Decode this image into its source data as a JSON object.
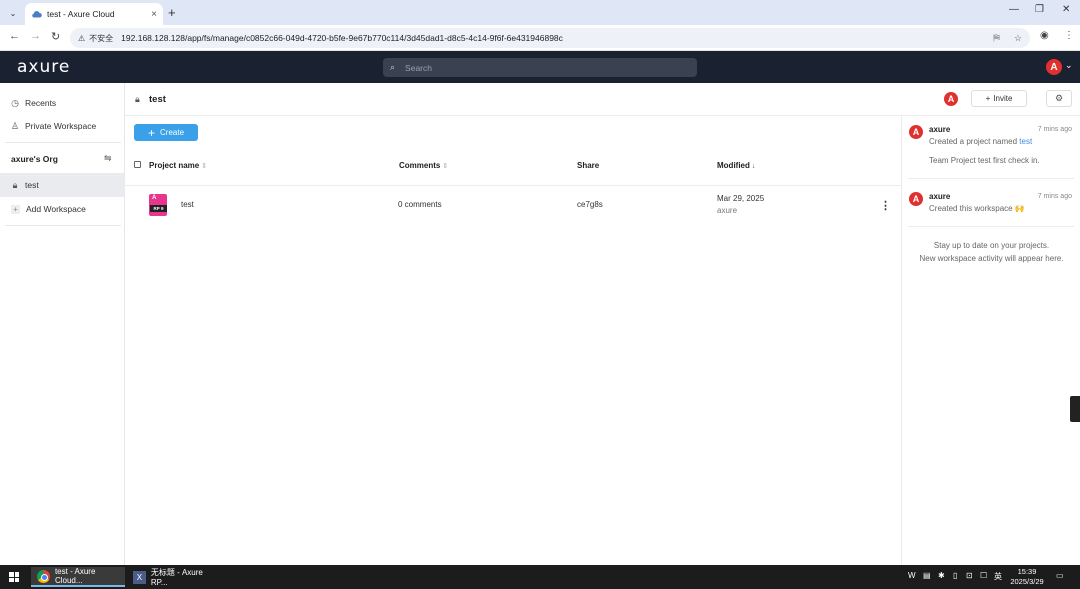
{
  "browser": {
    "tab_title": "test - Axure Cloud",
    "new_tab": "+",
    "tab_close": "×",
    "tab_dropdown": "⌄",
    "window_controls": {
      "minimize": "—",
      "restore": "❐",
      "close": "✕"
    },
    "nav": {
      "back": "←",
      "forward": "→",
      "reload": "↻"
    },
    "security_icon": "⚠",
    "security_label": "不安全",
    "url": "192.168.128.128/app/fs/manage/c0852c66-049d-4720-b5fe-9e67b770c114/3d45dad1-d8c5-4c14-9f6f-6e431946898c",
    "translate_icon": "⛿",
    "bookmark_icon": "☆",
    "profile_icon": "◉",
    "menu_icon": "⋮"
  },
  "app": {
    "logo": "axure",
    "search_placeholder": "Search",
    "search_icon": "⌕",
    "user_initial": "A",
    "user_chevron": "⌄"
  },
  "sidebar": {
    "recents": "Recents",
    "recents_icon": "◷",
    "private_workspace": "Private Workspace",
    "private_icon": "♙",
    "org_name": "axure's Org",
    "org_settings_icon": "⇋",
    "workspaces": [
      {
        "label": "test",
        "icon": "🔒︎"
      }
    ],
    "add_workspace": "Add Workspace",
    "add_icon": "+"
  },
  "main": {
    "workspace_title": "test",
    "lock_icon": "🔒︎",
    "create_label": "Create",
    "create_plus": "+",
    "columns": {
      "project_name": "Project name",
      "comments": "Comments",
      "share": "Share",
      "modified": "Modified"
    },
    "sort_neutral": "⇕",
    "sort_desc": "↓",
    "rows": [
      {
        "name": "test",
        "file_badge": "RP 9",
        "file_letter": "A",
        "comments": "0 comments",
        "share": "ce7g8s",
        "modified_date": "Mar 29, 2025",
        "modified_by": "axure",
        "more": "⋮"
      }
    ]
  },
  "right_panel": {
    "avatar_initial": "A",
    "invite_label": "Invite",
    "invite_plus": "+",
    "settings_icon": "⚙",
    "activities": [
      {
        "initial": "A",
        "user": "axure",
        "time": "7 mins ago",
        "text_prefix": "Created a project named",
        "link": "test",
        "detail": "Team Project test first check in."
      },
      {
        "initial": "A",
        "user": "axure",
        "time": "7 mins ago",
        "text_prefix": "Created this workspace",
        "emoji": "🙌"
      }
    ],
    "empty_line1": "Stay up to date on your projects.",
    "empty_line2": "New workspace activity will appear here."
  },
  "taskbar": {
    "apps": [
      {
        "label": "test - Axure Cloud..."
      },
      {
        "label": "无标题 - Axure RP..."
      }
    ],
    "tray_icons": [
      "W",
      "▤",
      "✱",
      "▯",
      "⊡",
      "☐",
      "🔊︎"
    ],
    "ime": "英",
    "time": "15:39",
    "date": "2025/3/29",
    "notify_icon": "▭"
  }
}
